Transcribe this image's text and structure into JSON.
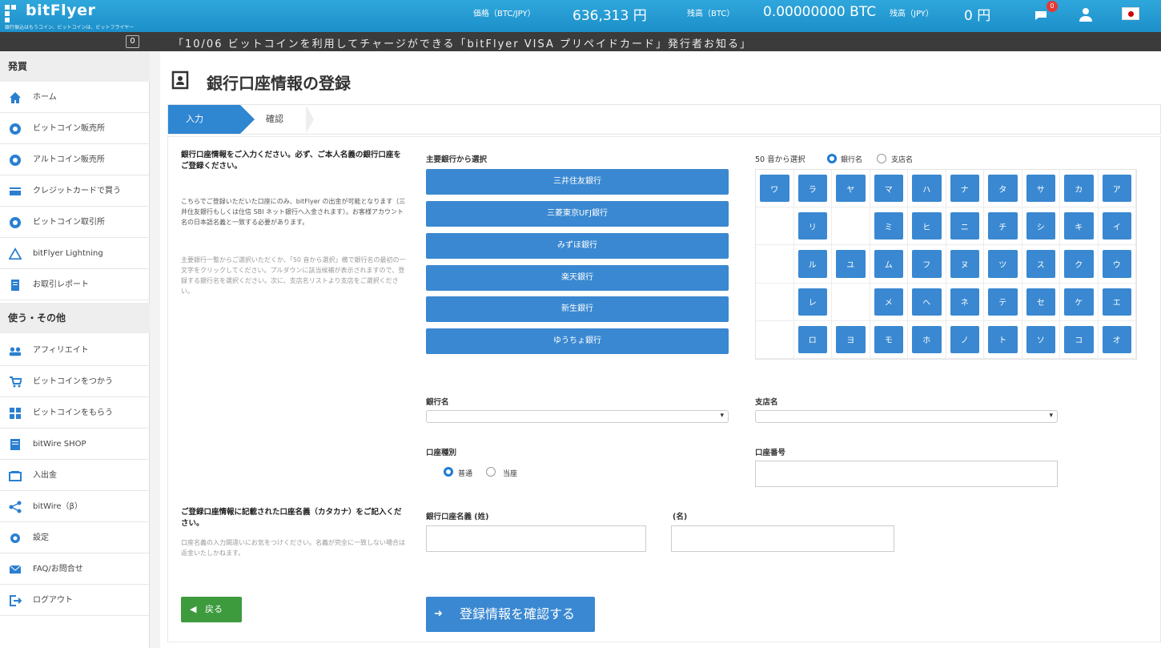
{
  "header": {
    "logo_text": "bitFlyer",
    "logo_sub": "銀行振込はもうコイン、ビットコインは、ビットフライヤー",
    "price_label": "価格（BTC/JPY）",
    "price_value": "636,313 円",
    "btc_label": "残高（BTC）",
    "btc_value": "0.00000000 BTC",
    "jpy_label": "残高（JPY）",
    "jpy_value": "0 円",
    "notification_count": "0",
    "accent_color": "#2a9bd5"
  },
  "news": {
    "toggle": "0",
    "text": "「10/06 ビットコインを利用してチャージができる「bitFlyer VISA プリペイドカード」発行者お知る」"
  },
  "sidebar": {
    "section1": "発買",
    "section2": "使う・その他",
    "items1": [
      {
        "label": "ホーム",
        "icon": "home-icon"
      },
      {
        "label": "ビットコイン販売所",
        "icon": "bitcoin-icon"
      },
      {
        "label": "アルトコイン販売所",
        "icon": "altcoin-icon"
      },
      {
        "label": "クレジットカードで買う",
        "icon": "credit-card-icon"
      },
      {
        "label": "ビットコイン取引所",
        "icon": "exchange-icon"
      },
      {
        "label": "bitFlyer Lightning",
        "icon": "lightning-icon"
      },
      {
        "label": "お取引レポート",
        "icon": "report-icon"
      }
    ],
    "items2": [
      {
        "label": "アフィリエイト",
        "icon": "affiliate-icon"
      },
      {
        "label": "ビットコインをつかう",
        "icon": "cart-icon"
      },
      {
        "label": "ビットコインをもらう",
        "icon": "gift-icon"
      },
      {
        "label": "bitWire SHOP",
        "icon": "shop-icon"
      },
      {
        "label": "入出金",
        "icon": "wallet-icon"
      },
      {
        "label": "bitWire（β）",
        "icon": "share-icon"
      },
      {
        "label": "設定",
        "icon": "gear-icon"
      },
      {
        "label": "FAQ/お問合せ",
        "icon": "mail-icon"
      },
      {
        "label": "ログアウト",
        "icon": "logout-icon"
      }
    ]
  },
  "page": {
    "title": "銀行口座情報の登録",
    "steps": [
      "入力",
      "確認"
    ]
  },
  "instructions": {
    "bold": "銀行口座情報をご入力ください。必ず、ご本人名義の銀行口座をご登録ください。",
    "text": "こちらでご登録いただいた口座にのみ、bitFlyer の出金が可能となります（三井住友銀行もしくは住信 SBI ネット銀行へ入金されます）。お客様アカウント名の日本語名義と一致する必要があります。",
    "faint": "主要銀行一覧からご選択いただくか、「50 音から選択」横で銀行名の最初の一文字をクリックしてください。プルダウンに該当候補が表示されますので、登録する銀行名を選択ください。次に、支店名リストより支店をご選択ください。"
  },
  "major_banks": {
    "label": "主要銀行から選択",
    "banks": [
      "三井住友銀行",
      "三菱東京UFJ銀行",
      "みずほ銀行",
      "楽天銀行",
      "新生銀行",
      "ゆうちょ銀行"
    ]
  },
  "kana_select": {
    "label": "50 音から選択",
    "option_bank": "銀行名",
    "option_branch": "支店名",
    "rows": [
      [
        "ワ",
        "ラ",
        "ヤ",
        "マ",
        "ハ",
        "ナ",
        "タ",
        "サ",
        "カ",
        "ア"
      ],
      [
        "",
        "リ",
        "",
        "ミ",
        "ヒ",
        "ニ",
        "チ",
        "シ",
        "キ",
        "イ"
      ],
      [
        "",
        "ル",
        "ユ",
        "ム",
        "フ",
        "ヌ",
        "ツ",
        "ス",
        "ク",
        "ウ"
      ],
      [
        "",
        "レ",
        "",
        "メ",
        "ヘ",
        "ネ",
        "テ",
        "セ",
        "ケ",
        "エ"
      ],
      [
        "",
        "ロ",
        "ヨ",
        "モ",
        "ホ",
        "ノ",
        "ト",
        "ソ",
        "コ",
        "オ"
      ]
    ]
  },
  "form": {
    "bank_name_label": "銀行名",
    "branch_name_label": "支店名",
    "account_type_label": "口座種別",
    "account_type_options": [
      "普通",
      "当座"
    ],
    "account_number_label": "口座番号",
    "holder_note": "ご登録口座情報に記載された口座名義（カタカナ）をご記入ください。",
    "holder_faint": "口座名義の入力間違いにお気をつけください。名義が完全に一致しない場合は返金いたしかねます。",
    "holder_last_label": "銀行口座名義 (姓)",
    "holder_first_label": "(名)",
    "back_button": "戻る",
    "confirm_button": "登録情報を確認する"
  }
}
